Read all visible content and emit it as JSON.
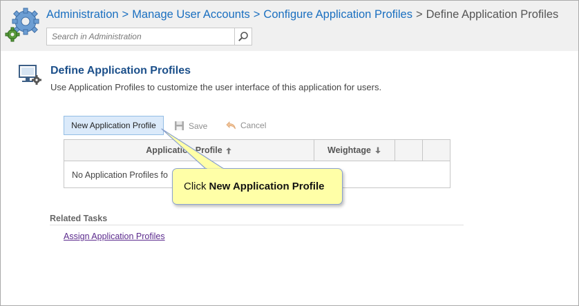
{
  "header": {
    "breadcrumb": [
      {
        "label": "Administration"
      },
      {
        "label": "Manage User Accounts"
      },
      {
        "label": "Configure Application Profiles"
      },
      {
        "label": "Define Application Profiles"
      }
    ],
    "separator": ">",
    "search": {
      "placeholder": "Search in Administration",
      "value": ""
    }
  },
  "page": {
    "title": "Define Application Profiles",
    "description": "Use Application Profiles to customize the user interface of this application for users."
  },
  "toolbar": {
    "new_label": "New Application Profile",
    "save_label": "Save",
    "cancel_label": "Cancel"
  },
  "table": {
    "columns": [
      {
        "label": "Application Profile",
        "sort": "up-arrow-icon"
      },
      {
        "label": "Weightage",
        "sort": "down-arrow-icon"
      },
      {
        "label": ""
      },
      {
        "label": ""
      }
    ],
    "empty_message": "No Application Profiles fo"
  },
  "callout": {
    "prefix": "Click",
    "emphasis": "New Application Profile"
  },
  "related": {
    "title": "Related Tasks",
    "links": [
      {
        "label": "Assign Application Profiles"
      }
    ]
  },
  "colors": {
    "link": "#1a6fc0",
    "title": "#1b4f8a",
    "callout_bg": "#ffffa7",
    "callout_border": "#8aa1cf",
    "button_bg": "#dbeafa",
    "visited_link": "#5b2a8d"
  }
}
